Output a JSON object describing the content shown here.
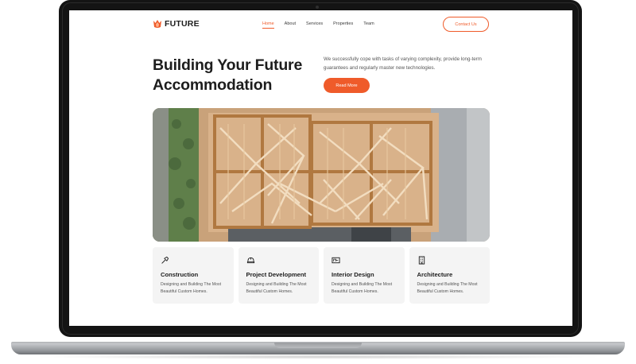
{
  "brand": {
    "name": "FUTURE",
    "icon": "crown-flame-icon",
    "accent_color": "#ef5b2a"
  },
  "nav": {
    "items": [
      {
        "label": "Home",
        "active": true
      },
      {
        "label": "About",
        "active": false
      },
      {
        "label": "Services",
        "active": false
      },
      {
        "label": "Properties",
        "active": false
      },
      {
        "label": "Team",
        "active": false
      }
    ],
    "contact_label": "Contact Us"
  },
  "hero": {
    "title_line1": "Building Your Future",
    "title_line2": "Accommodation",
    "description": "We successfully cope with tasks of varying complexity, provide long-term guarantees and regularly master new technologies.",
    "button_label": "Read More",
    "image": "aerial-construction-framing-photo"
  },
  "services": [
    {
      "icon": "trowel-icon",
      "title": "Construction",
      "description": "Designing and Building The Most Beautiful Custom Homes."
    },
    {
      "icon": "hard-hat-icon",
      "title": "Project Development",
      "description": "Designing and Building The Most Beautiful Custom Homes."
    },
    {
      "icon": "blueprint-icon",
      "title": "Interior Design",
      "description": "Designing and Building The Most Beautiful Custom Homes."
    },
    {
      "icon": "building-icon",
      "title": "Architecture",
      "description": "Designing and Building The Most Beautiful Custom Homes."
    }
  ]
}
